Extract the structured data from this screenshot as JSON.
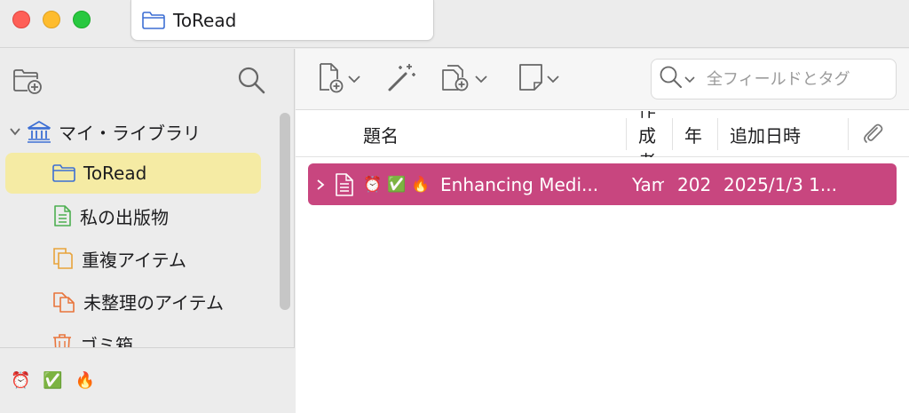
{
  "window": {
    "tab_title": "ToRead"
  },
  "sidebar": {
    "library": "マイ・ライブラリ",
    "items": [
      {
        "label": "ToRead",
        "icon": "folder-icon",
        "selected": true
      },
      {
        "label": "私の出版物",
        "icon": "document-icon"
      },
      {
        "label": "重複アイテム",
        "icon": "duplicate-icon"
      },
      {
        "label": "未整理のアイテム",
        "icon": "unfiled-icon"
      },
      {
        "label": "ゴミ箱",
        "icon": "trash-icon"
      }
    ],
    "tags": [
      "⏰",
      "✅",
      "🔥"
    ]
  },
  "search": {
    "placeholder": "全フィールドとタグ"
  },
  "columns": {
    "title": "題名",
    "creator": "作成者",
    "year": "年",
    "date_added": "追加日時"
  },
  "items": [
    {
      "emojis": [
        "⏰",
        "✅",
        "🔥"
      ],
      "title": "Enhancing Medi...",
      "creator": "Yam",
      "year": "202",
      "date_added": "2025/1/3 1..."
    }
  ],
  "colors": {
    "selection_sidebar": "#f5eba4",
    "selection_row": "#c8467f",
    "accent_blue": "#3d6fd4"
  }
}
